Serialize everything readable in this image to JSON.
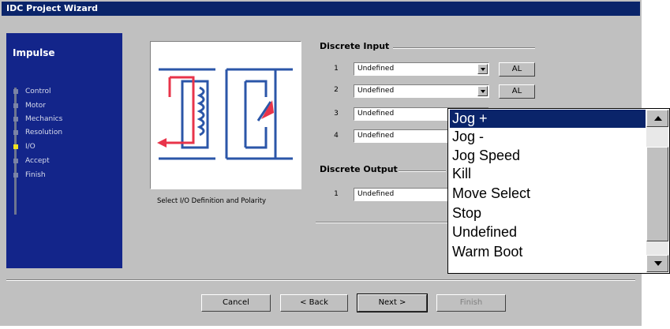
{
  "window": {
    "title": "IDC Project Wizard"
  },
  "nav": {
    "title": "Impulse",
    "items": [
      {
        "label": "Control"
      },
      {
        "label": "Motor"
      },
      {
        "label": "Mechanics"
      },
      {
        "label": "Resolution"
      },
      {
        "label": "I/O",
        "active": true
      },
      {
        "label": "Accept"
      },
      {
        "label": "Finish"
      }
    ]
  },
  "diagram": {
    "caption": "Select I/O Definition and Polarity",
    "icon": "relay-diagram-icon"
  },
  "discrete_input": {
    "title": "Discrete Input",
    "rows": [
      {
        "num": "1",
        "value": "Undefined",
        "button": "AL"
      },
      {
        "num": "2",
        "value": "Undefined",
        "button": "AL"
      },
      {
        "num": "3",
        "value": "Undefined"
      },
      {
        "num": "4",
        "value": "Undefined"
      }
    ]
  },
  "discrete_output": {
    "title": "Discrete Output",
    "rows": [
      {
        "num": "1",
        "value": "Undefined"
      }
    ]
  },
  "buttons": {
    "cancel": "Cancel",
    "back": "< Back",
    "next": "Next >",
    "finish": "Finish"
  },
  "dropdown": {
    "options": [
      "Jog +",
      "Jog -",
      "Jog Speed",
      "Kill",
      "Move Select",
      "Stop",
      "Undefined",
      "Warm Boot"
    ],
    "highlighted": "Jog +"
  },
  "colors": {
    "titlebar": "#0a246a",
    "nav_panel": "#13258a",
    "active_marker": "#f0e020",
    "selection": "#0a246a",
    "diagram_blue": "#2b56a8",
    "diagram_red": "#e8344a"
  }
}
